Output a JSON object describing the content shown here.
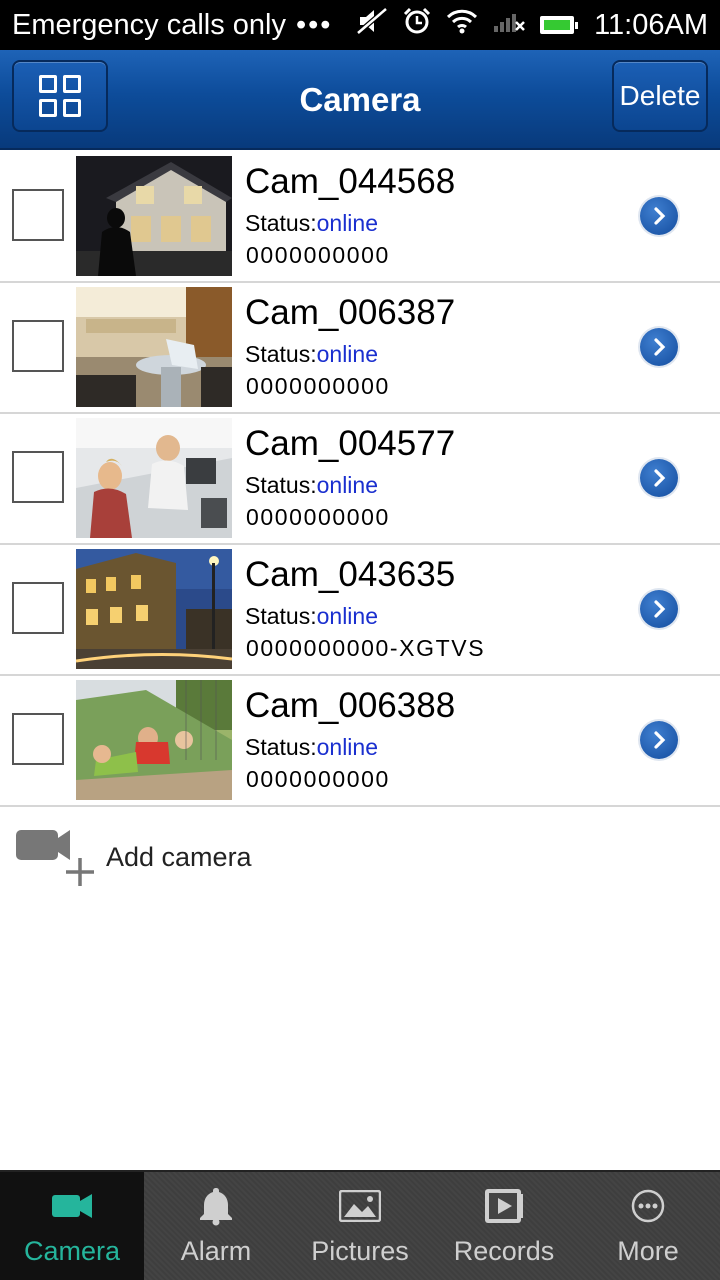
{
  "status_bar": {
    "carrier_text": "Emergency calls only",
    "dots": "•••",
    "time": "11:06AM",
    "icons": [
      "muted-speaker-icon",
      "alarm-clock-icon",
      "wifi-icon",
      "signal-icon",
      "battery-icon"
    ]
  },
  "header": {
    "title": "Camera",
    "grid_icon": "grid-view-icon",
    "delete_label": "Delete"
  },
  "colors": {
    "header_blue": "#0d4c9a",
    "status_online": "#1a2fcf",
    "active_tab": "#25b59c"
  },
  "cameras": [
    {
      "name": "Cam_044568",
      "status_label": "Status:",
      "status": "online",
      "id": "0000000000"
    },
    {
      "name": "Cam_006387",
      "status_label": "Status:",
      "status": "online",
      "id": "0000000000"
    },
    {
      "name": "Cam_004577",
      "status_label": "Status:",
      "status": "online",
      "id": "0000000000"
    },
    {
      "name": "Cam_043635",
      "status_label": "Status:",
      "status": "online",
      "id": "0000000000-XGTVS"
    },
    {
      "name": "Cam_006388",
      "status_label": "Status:",
      "status": "online",
      "id": "0000000000"
    }
  ],
  "add_camera": {
    "label": "Add camera",
    "icon": "add-video-camera-icon"
  },
  "nav": [
    {
      "label": "Camera",
      "icon": "video-camera-icon",
      "active": true
    },
    {
      "label": "Alarm",
      "icon": "bell-icon",
      "active": false
    },
    {
      "label": "Pictures",
      "icon": "picture-icon",
      "active": false
    },
    {
      "label": "Records",
      "icon": "records-play-icon",
      "active": false
    },
    {
      "label": "More",
      "icon": "more-dots-icon",
      "active": false
    }
  ]
}
